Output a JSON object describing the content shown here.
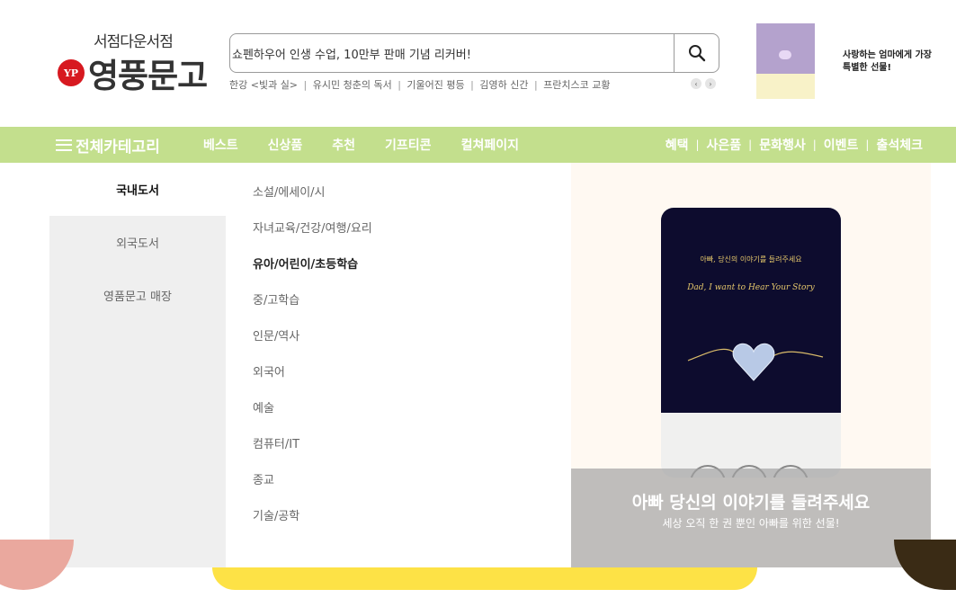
{
  "header": {
    "logo": {
      "subtitle": "서점다운서점",
      "name": "영풍문고",
      "badge": "YP"
    },
    "search": {
      "value": "쇼펜하우어 인생 수업, 10만부 판매 기념 리커버!"
    },
    "keywords": [
      "한강 <빛과 실>",
      "유시민 청춘의 독서",
      "기울어진 평등",
      "김영하 신간",
      "프란치스코 교황"
    ],
    "promo": {
      "text": "사랑하는 엄마에게 가장 특별한 선물!"
    }
  },
  "nav": {
    "all_categories": "전체카테고리",
    "menu": [
      "베스트",
      "신상품",
      "추천",
      "기프티콘",
      "컬쳐페이지"
    ],
    "right": [
      "혜택",
      "사은품",
      "문화행사",
      "이벤트",
      "출석체크"
    ]
  },
  "dropdown": {
    "left": [
      "국내도서",
      "외국도서",
      "영품문고 매장"
    ],
    "middle": [
      "소설/에세이/시",
      "자녀교육/건강/여행/요리",
      "유아/어린이/초등학습",
      "중/고학습",
      "인문/역사",
      "외국어",
      "예술",
      "컴퓨터/IT",
      "종교",
      "기술/공학"
    ]
  },
  "banner": {
    "book_title_kr": "아빠, 당신의 이야기를 들려주세요",
    "book_title_en": "Dad, I want to Hear Your Story",
    "title": "아빠 당신의 이야기를 들려주세요",
    "subtitle": "세상 오직 한 권 뿐인 아빠를 위한 선물!"
  },
  "colors": {
    "nav_bg": "#c3df8d",
    "brand_red": "#d71920",
    "deco_yellow": "#fde246",
    "deco_pink": "#eaa89e",
    "deco_brown": "#3a2b15"
  }
}
